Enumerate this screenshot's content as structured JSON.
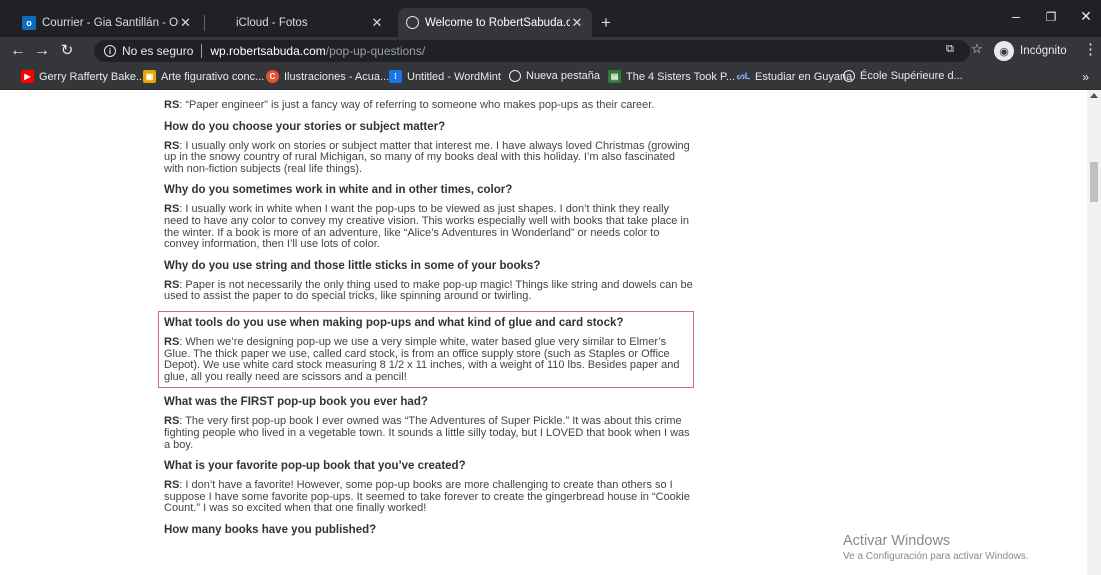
{
  "tabs": [
    {
      "title": "Courrier - Gia Santillán - Outlook",
      "icon": "outlook-icon",
      "color": "#0f6cbd"
    },
    {
      "title": "iCloud - Fotos",
      "icon": "apple-icon",
      "color": "#e8eaed"
    },
    {
      "title": "Welcome to RobertSabuda.com!",
      "icon": "globe-icon",
      "color": "#e8eaed"
    }
  ],
  "toolbar": {
    "security_label": "No es seguro",
    "url_host": "wp.robertsabuda.com",
    "url_path": "/pop-up-questions/",
    "incognito_label": "Incógnito"
  },
  "bookmarks": [
    {
      "label": "Gerry Rafferty Bake...",
      "icon": "youtube-icon",
      "color": "#ff0000"
    },
    {
      "label": "Arte figurativo conc...",
      "icon": "image-icon",
      "color": "#e6a800"
    },
    {
      "label": "Ilustraciones - Acua...",
      "icon": "c-logo-icon",
      "color": "#e5522e"
    },
    {
      "label": "Untitled - WordMint",
      "icon": "wordmint-icon",
      "color": "#1a73e8"
    },
    {
      "label": "Nueva pestaña",
      "icon": "globe-icon",
      "color": "#e8eaed"
    },
    {
      "label": "The 4 Sisters Took P...",
      "icon": "sisters-icon",
      "color": "#2e7d32"
    },
    {
      "label": "Estudiar en Guyana",
      "icon": "sl-logo-icon",
      "color": "#1a73e8"
    },
    {
      "label": "École Supérieure d...",
      "icon": "globe-icon",
      "color": "#e8eaed"
    }
  ],
  "content": {
    "intro_prefix": "RS",
    "intro": ": “Paper engineer” is just a fancy way of referring to someone who makes pop-ups as their career.",
    "qa": [
      {
        "q": "How do you choose your stories or subject matter?",
        "prefix": "RS",
        "a": ": I usually only work on stories or subject matter that interest me. I have always loved Christmas (growing up in the snowy country of rural Michigan, so many of my books deal with this holiday. I’m also fascinated with non-fiction subjects (real life things)."
      },
      {
        "q": "Why do you sometimes work in white and in other times, color?",
        "prefix": "RS",
        "a": ": I usually work in white when I want the pop-ups to be viewed as just shapes. I don’t think they really need to have any color to convey my creative vision. This works especially well with books that take place in the winter. If a book is more of an adventure, like “Alice’s Adventures in Wonderland” or needs color to convey information, then I’ll use lots of color."
      },
      {
        "q": "Why do you use string and those little sticks in some of your books?",
        "prefix": "RS",
        "a": ": Paper is not necessarily the only thing used to make pop-up magic! Things like string and dowels can be used to assist the paper to do special tricks, like spinning around or twirling."
      },
      {
        "q": "What tools do you use when making pop-ups and what kind of glue and card stock?",
        "prefix": "RS",
        "a": ": When we’re designing pop-up we use a very simple white, water based glue very similar to Elmer’s Glue. The thick paper we use, called card stock, is from an office supply store (such as Staples or Office Depot). We use white card stock measuring 8 1/2 x 11 inches, with a weight of 110 lbs. Besides paper and glue, all you really need are scissors and a pencil!"
      },
      {
        "q": "What was the FIRST pop-up book you ever had?",
        "prefix": "RS",
        "a": ": The very first pop-up book I ever owned was “The Adventures of Super Pickle.” It was about this crime fighting people who lived in a vegetable town. It sounds a little silly today, but I LOVED that book when I was a boy."
      },
      {
        "q": "What is your favorite pop-up book that you’ve created?",
        "prefix": "RS",
        "a": ": I don’t have a favorite! However, some pop-up books are more challenging to create than others so I suppose I have some favorite pop-ups. It seemed to take forever to create the gingerbread house in “Cookie Count.” I was so excited when that one finally worked!"
      }
    ],
    "last_q": "How many books have you published?"
  },
  "watermark": {
    "title": "Activar Windows",
    "subtitle": "Ve a Configuración para activar Windows."
  },
  "colors": {
    "tabstrip": "#202124",
    "toolbar": "#35363a",
    "highlight_border": "#d06d78"
  }
}
